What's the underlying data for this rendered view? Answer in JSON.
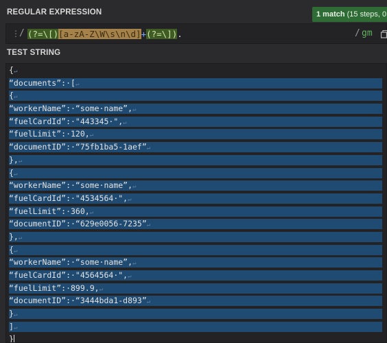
{
  "regex_section": {
    "title": "REGULAR EXPRESSION",
    "match_badge_strong": "1 match",
    "match_badge_detail": " (15 steps, 0.1ms",
    "delimiter_open": "/",
    "delimiter_close": "/",
    "flags": "gm",
    "pattern_tokens": [
      {
        "text": "(?=\\[)",
        "kind": "look"
      },
      {
        "text": "[a-zA-Z\\W\\s\\n\\d]",
        "kind": "class"
      },
      {
        "text": "+",
        "kind": "quant"
      },
      {
        "text": "(?=\\])",
        "kind": "look"
      },
      {
        "text": ".",
        "kind": "plain"
      }
    ]
  },
  "test_section": {
    "title": "TEST STRING",
    "lines": [
      {
        "text": "{",
        "hl": false
      },
      {
        "text": "“documents”:·[",
        "hl": true
      },
      {
        "text": "{",
        "hl": true
      },
      {
        "text": "“workerName”:·“some·name”,",
        "hl": true
      },
      {
        "text": "“fuelCardId”:·\"443345·\",",
        "hl": true
      },
      {
        "text": "“fuelLimit”:·120,",
        "hl": true
      },
      {
        "text": "“documentID”:·“75fb1ba5-1aef”",
        "hl": true
      },
      {
        "text": "},",
        "hl": true
      },
      {
        "text": "{",
        "hl": true
      },
      {
        "text": "“workerName”:·“some·name”,",
        "hl": true
      },
      {
        "text": "“fuelCardId”:·\"4534564·\",",
        "hl": true
      },
      {
        "text": "“fuelLimit”:·360,",
        "hl": true
      },
      {
        "text": "“documentID”:·“629e0056-7235”",
        "hl": true
      },
      {
        "text": "},",
        "hl": true
      },
      {
        "text": "{",
        "hl": true
      },
      {
        "text": "“workerName”:·“some·name”,",
        "hl": true
      },
      {
        "text": "“fuelCardId”:·\"4564564·\",",
        "hl": true
      },
      {
        "text": "“fuelLimit”:·899.9,",
        "hl": true
      },
      {
        "text": "“documentID”:·“3444bda1-d893”",
        "hl": true
      },
      {
        "text": "}",
        "hl": true
      },
      {
        "text": "]",
        "hl": true
      },
      {
        "text": "}",
        "hl": false
      }
    ]
  },
  "icons": {
    "drag": "drag-handle-icon",
    "copy": "copy-icon",
    "newline": "newline-icon"
  },
  "colors": {
    "highlight": "#1f4a72",
    "badge": "#2f6b34",
    "flags": "#5fb05f"
  }
}
